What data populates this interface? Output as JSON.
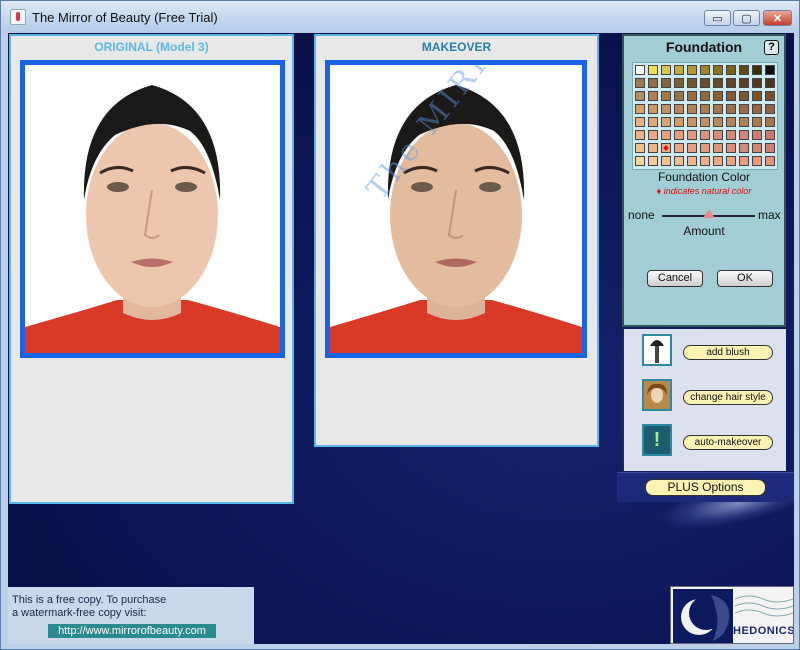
{
  "window": {
    "title": "The Mirror of Beauty (Free Trial)",
    "controls": {
      "minimize": "▭",
      "maximize": "▢",
      "close": "✕"
    }
  },
  "original_panel": {
    "title": "ORIGINAL (Model 3)",
    "title_color": "#5ab8e6"
  },
  "makeover_panel": {
    "title": "MAKEOVER",
    "title_color": "#2a7fa8",
    "watermark": "The MIRROR"
  },
  "foundation": {
    "title": "Foundation",
    "help_label": "?",
    "color_label": "Foundation Color",
    "natural_note": "♦ indicates natural color",
    "amount_min": "none",
    "amount_max": "max",
    "amount_label": "Amount",
    "amount_value": 0.5,
    "cancel_label": "Cancel",
    "ok_label": "OK",
    "selected_swatch": {
      "row": 6,
      "col": 2
    },
    "swatches": [
      [
        "#ffffff",
        "#f2e24a",
        "#d9c24a",
        "#c7a93a",
        "#b39832",
        "#9f862b",
        "#8a7424",
        "#78641c",
        "#5c4c13",
        "#3a300a",
        "#101010"
      ],
      [
        "#9a7a52",
        "#8f7048",
        "#86683f",
        "#7c5f38",
        "#745633",
        "#6c4f2f",
        "#65492b",
        "#5e4428",
        "#583f25",
        "#523a22",
        "#4a341e"
      ],
      [
        "#b58a5d",
        "#ad8256",
        "#a57a4f",
        "#9e7349",
        "#976d44",
        "#90683f",
        "#8a623a",
        "#845c36",
        "#7f5832",
        "#7a542f",
        "#744f2c"
      ],
      [
        "#d5a06e",
        "#cc9867",
        "#c49061",
        "#bc885b",
        "#b58256",
        "#ae7c52",
        "#a8764e",
        "#a2714a",
        "#9c6c47",
        "#966844",
        "#906441"
      ],
      [
        "#e7b27d",
        "#e0aa77",
        "#d8a271",
        "#d19b6b",
        "#ca9566",
        "#c48f61",
        "#be8a5d",
        "#b88559",
        "#b28055",
        "#ad7b52",
        "#a7764e"
      ],
      [
        "#efae86",
        "#eba886",
        "#e8a282",
        "#e49c80",
        "#e0977e",
        "#dc927c",
        "#d88d7a",
        "#d48878",
        "#d08376",
        "#cc7e74",
        "#c87972"
      ],
      [
        "#f3c08c",
        "#f0b487",
        "#ecac84",
        "#e8a682",
        "#e59f80",
        "#e1997e",
        "#dd937c",
        "#da8e7a",
        "#d68878",
        "#d38376",
        "#cf7e74"
      ],
      [
        "#f9d2a0",
        "#f7c99b",
        "#f5c196",
        "#f3ba92",
        "#f1b38e",
        "#efad8a",
        "#eda786",
        "#eba282",
        "#e99c7f",
        "#e7977c",
        "#e59279"
      ]
    ]
  },
  "tools": {
    "blush_label": "add blush",
    "hair_label": "change hair style",
    "auto_label": "auto-makeover",
    "auto_icon_glyph": "!"
  },
  "plus_options_label": "PLUS Options",
  "free_copy": {
    "line1": "This is a free copy.  To purchase",
    "line2": "a watermark-free copy visit:",
    "url": "http://www.mirrorofbeauty.com"
  },
  "logo": {
    "text": "HEDONICS"
  },
  "colors": {
    "accent_blue": "#1b63e6",
    "panel_border": "#59b7e8",
    "dialog_bg": "#a3cdd4",
    "button_yellow": "#fbf3b4"
  }
}
